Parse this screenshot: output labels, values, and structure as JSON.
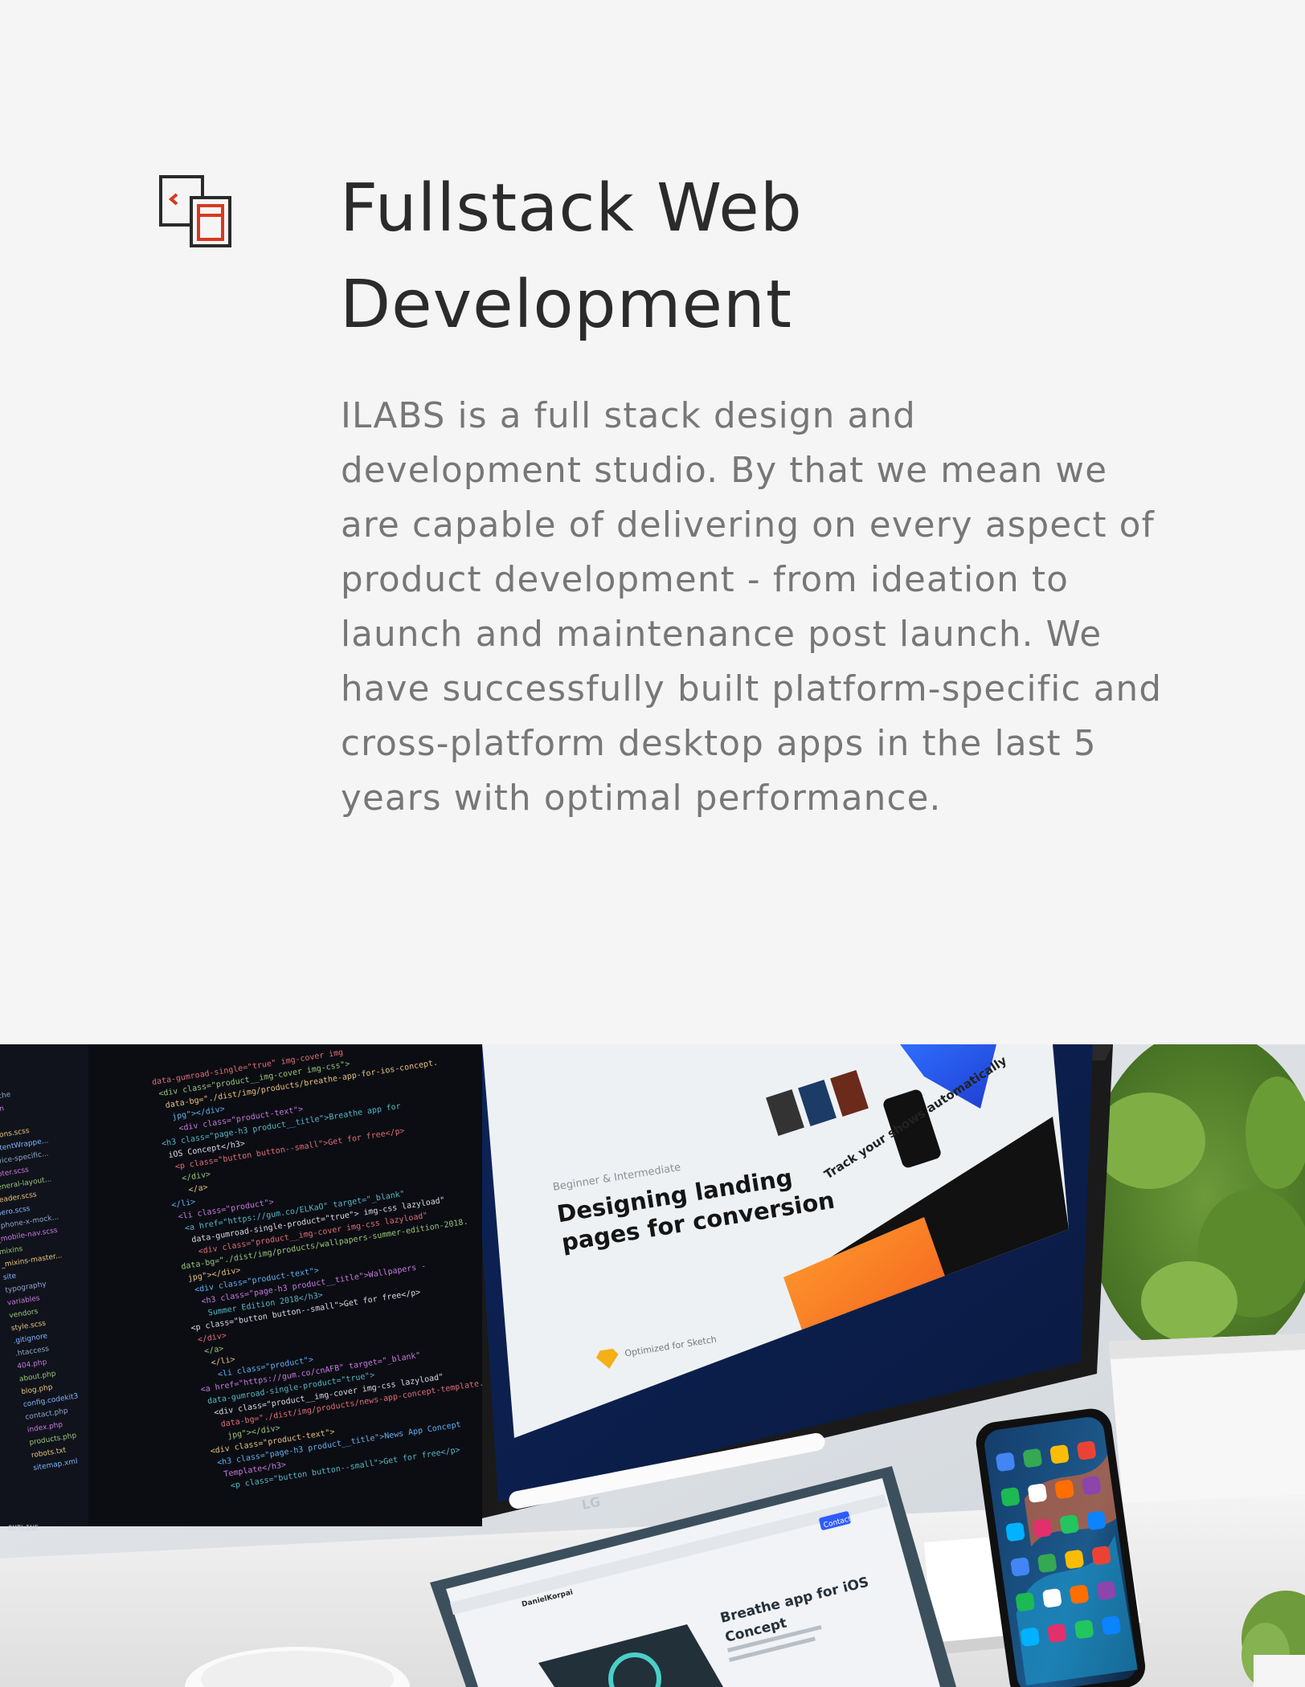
{
  "service": {
    "icon": "web-app-window-icon",
    "title": "Fullstack Web Development",
    "description": "ILABS is a full stack design and development studio. By that we mean we are capable of delivering on every aspect of product development - from ideation to launch and maintenance post launch. We have successfully built platform-specific and cross-platform desktop apps in the last 5 years with optimal performance."
  },
  "photo": {
    "code_lines": [
      "data-gumroad-single=\"true\" img-cover img",
      "<div class=\"product__img-cover img-css\">",
      "data-bg=\"./dist/img/products/breathe-app-for-ios-concept.",
      "jpg\"></div>",
      "<div class=\"product-text\">",
      "<h3 class=\"page-h3 product__title\">Breathe app for",
      "iOS Concept</h3>",
      "<p class=\"button button--small\">Get for free</p>",
      "</div>",
      "</a>",
      "</li>",
      "<li class=\"product\">",
      "<a href=\"https://gum.co/ELKaO\" target=\"_blank\"",
      "data-gumroad-single-product=\"true\"> img-css lazyload\"",
      "<div class=\"product__img-cover img-css lazyload\"",
      "data-bg=\"./dist/img/products/wallpapers-summer-edition-2018.",
      "jpg\"></div>",
      "<div class=\"product-text\">",
      "<h3 class=\"page-h3 product__title\">Wallpapers -",
      "Summer Edition 2018</h3>",
      "<p class=\"button button--small\">Get for free</p>",
      "</div>",
      "</a>",
      "</li>",
      "<li class=\"product\">",
      "<a href=\"https://gum.co/cnAFB\" target=\"_blank\"",
      "data-gumroad-single-product=\"true\">",
      "<div class=\"product__img-cover img-css lazyload\"",
      "data-bg=\"./dist/img/products/news-app-concept-template.",
      "jpg\"></div>",
      "<div class=\"product-text\">",
      "<h3 class=\"page-h3 product__title\">News App Concept",
      "Template</h3>",
      "<p class=\"button button--small\">Get for free</p>"
    ],
    "file_tree": [
      "ass-cache",
      "imation",
      "ayout",
      "_buttons.scss",
      "_contentWrappe...",
      "_device-specific...",
      "_footer.scss",
      "_general-layout...",
      "_header.scss",
      "_hero.scss",
      "_iphone-x-mock...",
      "_mobile-nav.scss",
      "mixins",
      "_mixins-master...",
      "site",
      "typography",
      "variables",
      "vendors",
      "style.scss",
      ".gitignore",
      ".htaccess",
      "404.php",
      "about.php",
      "blog.php",
      "config.codekit3",
      "contact.php",
      "index.php",
      "products.php",
      "robots.txt",
      "sitemap.xml"
    ],
    "outline_label": "OUTLINE",
    "monitor_kicker": "Beginner & Intermediate",
    "monitor_heading_line1": "Designing landing",
    "monitor_heading_line2": "pages for conversion",
    "monitor_badge": "Optimized for Sketch",
    "monitor_card_text": "Track your shows automatically",
    "monitor_brand": "LG",
    "tablet_heading_line1": "Breathe app for iOS",
    "tablet_heading_line2": "Concept",
    "tablet_name": "DanielKorpai",
    "tablet_button": "Contact"
  }
}
